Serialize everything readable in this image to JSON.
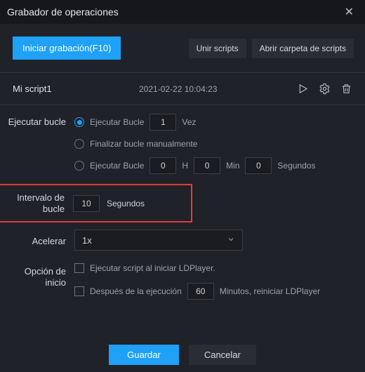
{
  "titlebar": {
    "title": "Grabador de operaciones"
  },
  "toolbar": {
    "record_label": "Iniciar grabación(F10)",
    "merge_label": "Unir scripts",
    "open_folder_label": "Abrir carpeta de scripts"
  },
  "script": {
    "name": "Mi script1",
    "date": "2021-02-22 10:04:23"
  },
  "loop": {
    "section_label": "Ejecutar bucle",
    "opt_count_label": "Ejecutar Bucle",
    "count_value": "1",
    "count_suffix": "Vez",
    "opt_manual_label": "Finalizar bucle manualmente",
    "opt_duration_label": "Ejecutar Bucle",
    "h_value": "0",
    "h_label": "H",
    "m_value": "0",
    "m_label": "Min",
    "s_value": "0",
    "s_label": "Segundos"
  },
  "interval": {
    "label": "Intervalo de bucle",
    "value": "10",
    "unit": "Segundos"
  },
  "accel": {
    "label": "Acelerar",
    "value": "1x"
  },
  "startup": {
    "label": "Opción de inicio",
    "on_launch_label": "Ejecutar script al iniciar LDPlayer.",
    "after_exec_label": "Después de la ejecución",
    "minutes_value": "60",
    "minutes_suffix": "Minutos, reiniciar LDPlayer"
  },
  "footer": {
    "save": "Guardar",
    "cancel": "Cancelar"
  }
}
